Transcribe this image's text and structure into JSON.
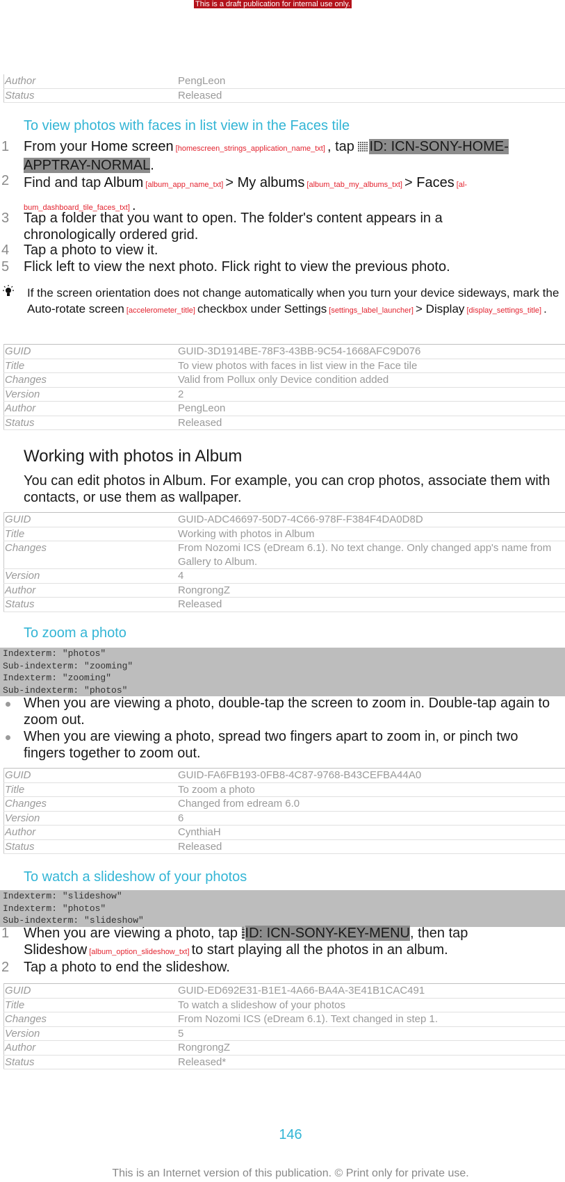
{
  "banner": "This is a draft publication for internal use only.",
  "meta_tables": [
    {
      "rows": [
        {
          "key": "Author",
          "value": "PengLeon"
        },
        {
          "key": "Status",
          "value": "Released"
        }
      ]
    },
    {
      "rows": [
        {
          "key": "GUID",
          "value": "GUID-3D1914BE-78F3-43BB-9C54-1668AFC9D076"
        },
        {
          "key": "Title",
          "value": "To view photos with faces in list view in the Face tile"
        },
        {
          "key": "Changes",
          "value": "Valid from Pollux only Device condition added"
        },
        {
          "key": "Version",
          "value": "2"
        },
        {
          "key": "Author",
          "value": "PengLeon"
        },
        {
          "key": "Status",
          "value": "Released"
        }
      ]
    },
    {
      "rows": [
        {
          "key": "GUID",
          "value": "GUID-ADC46697-50D7-4C66-978F-F384F4DA0D8D"
        },
        {
          "key": "Title",
          "value": "Working with photos in Album"
        },
        {
          "key": "Changes",
          "value": "From Nozomi ICS (eDream 6.1). No text change. Only changed app's name from Gallery to Album."
        },
        {
          "key": "Version",
          "value": "4"
        },
        {
          "key": "Author",
          "value": "RongrongZ"
        },
        {
          "key": "Status",
          "value": "Released"
        }
      ]
    },
    {
      "rows": [
        {
          "key": "GUID",
          "value": "GUID-FA6FB193-0FB8-4C87-9768-B43CEFBA44A0"
        },
        {
          "key": "Title",
          "value": "To zoom a photo"
        },
        {
          "key": "Changes",
          "value": "Changed from edream 6.0"
        },
        {
          "key": "Version",
          "value": "6"
        },
        {
          "key": "Author",
          "value": "CynthiaH"
        },
        {
          "key": "Status",
          "value": "Released"
        }
      ]
    },
    {
      "rows": [
        {
          "key": "GUID",
          "value": "GUID-ED692E31-B1E1-4A66-BA4A-3E41B1CAC491"
        },
        {
          "key": "Title",
          "value": "To watch a slideshow of your photos"
        },
        {
          "key": "Changes",
          "value": "From Nozomi ICS (eDream 6.1). Text changed in step 1."
        },
        {
          "key": "Version",
          "value": "5"
        },
        {
          "key": "Author",
          "value": "RongrongZ"
        },
        {
          "key": "Status",
          "value": "Released*"
        }
      ]
    }
  ],
  "faces": {
    "heading": "To view photos with faces in list view in the Faces tile",
    "steps": [
      {
        "num": "1",
        "t1": "From your ",
        "b1": "Home screen",
        "r1": " [homescreen_strings_application_name_txt] ",
        "t2": ", tap ",
        "icon_id": "ID: ICN-SONY-HOME-APPTRAY-NORMAL",
        "t3": "."
      },
      {
        "num": "2",
        "t1": "Find and tap ",
        "b1": "Album",
        "r1": " [album_app_name_txt] ",
        "t2": "> ",
        "b2": "My albums",
        "r2": " [album_tab_my_albums_txt] ",
        "t3": "> ",
        "b3": "Faces",
        "r3": " [al-bum_dashboard_tile_faces_txt] ",
        "t4": "."
      },
      {
        "num": "3",
        "text": "Tap a folder that you want to open. The folder's content appears in a chronologically ordered grid."
      },
      {
        "num": "4",
        "text": "Tap a photo to view it."
      },
      {
        "num": "5",
        "text": "Flick left to view the next photo. Flick right to view the previous photo."
      }
    ],
    "tip": {
      "icon": "lightbulb-icon",
      "t1": "If the screen orientation does not change automatically when you turn your device sideways, mark the ",
      "b1": "Auto-rotate screen",
      "r1": " [accelerometer_title] ",
      "t2": "checkbox under ",
      "b2": "Settings",
      "r2": " [settings_label_launcher] ",
      "t3": "> ",
      "b3": "Display",
      "r3": " [display_settings_title] ",
      "t4": "."
    }
  },
  "working": {
    "heading": "Working with photos in Album",
    "paragraph": "You can edit photos in Album. For example, you can crop photos, associate them with contacts, or use them as wallpaper."
  },
  "zoom": {
    "heading": "To zoom a photo",
    "indexterms": [
      "Indexterm: \"photos\"",
      "Sub-indexterm: \"zooming\"",
      "Indexterm: \"zooming\"",
      "Sub-indexterm: \"photos\""
    ],
    "bullets": [
      "When you are viewing a photo, double-tap the screen to zoom in. Double-tap again to zoom out.",
      "When you are viewing a photo, spread two fingers apart to zoom in, or pinch two fingers together to zoom out."
    ]
  },
  "slideshow": {
    "heading": "To watch a slideshow of your photos",
    "indexterms": [
      "Indexterm: \"slideshow\"",
      "Indexterm: \"photos\"",
      "Sub-indexterm: \"slideshow\""
    ],
    "steps": [
      {
        "num": "1",
        "t1": "When you are viewing a photo, tap ",
        "icon_id": "ID: ICN-SONY-KEY-MENU",
        "t2": ", then tap ",
        "b1": "Slideshow",
        "r1": " [album_option_slideshow_txt] ",
        "t3": "to start playing all the photos in an album."
      },
      {
        "num": "2",
        "text": "Tap a photo to end the slideshow."
      }
    ]
  },
  "page_number": "146",
  "footer": "This is an Internet version of this publication. © Print only for private use."
}
